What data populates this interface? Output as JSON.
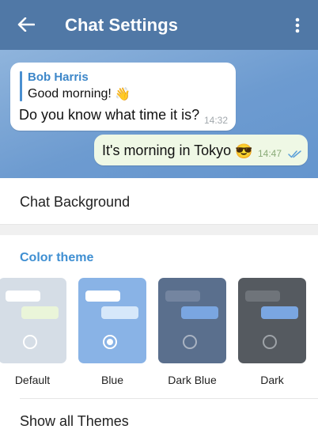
{
  "app_bar": {
    "title": "Chat Settings",
    "back_icon": "back-arrow-icon",
    "menu_icon": "more-vertical-icon",
    "color": "#5078a6"
  },
  "preview": {
    "incoming": {
      "reply_name": "Bob Harris",
      "reply_text": "Good morning!",
      "reply_emoji": "👋",
      "message": "Do you know what time it is?",
      "time": "14:32"
    },
    "outgoing": {
      "message": "It's morning in Tokyo",
      "emoji": "😎",
      "time": "14:47",
      "status_icon": "double-check-icon"
    }
  },
  "chat_background": {
    "label": "Chat Background"
  },
  "color_theme": {
    "header": "Color theme",
    "accent": "#3f8fd2",
    "themes": [
      {
        "name": "Default",
        "selected": false,
        "bg": "#d5dde6",
        "bubble_in": "#ffffff",
        "bubble_out": "#eaf5d9",
        "radio": "#ffffff"
      },
      {
        "name": "Blue",
        "selected": true,
        "bg": "#89b3e6",
        "bubble_in": "#ffffff",
        "bubble_out": "#d6e8fa",
        "radio": "#ffffff"
      },
      {
        "name": "Dark Blue",
        "selected": false,
        "bg": "#5a6f8d",
        "bubble_in": "#7485a0",
        "bubble_out": "#7aa6e1",
        "radio": "#a9b3c2"
      },
      {
        "name": "Dark",
        "selected": false,
        "bg": "#555a60",
        "bubble_in": "#6f747a",
        "bubble_out": "#7aa6e1",
        "radio": "#9ea3a8"
      }
    ]
  },
  "show_all_themes": {
    "label": "Show all Themes"
  }
}
